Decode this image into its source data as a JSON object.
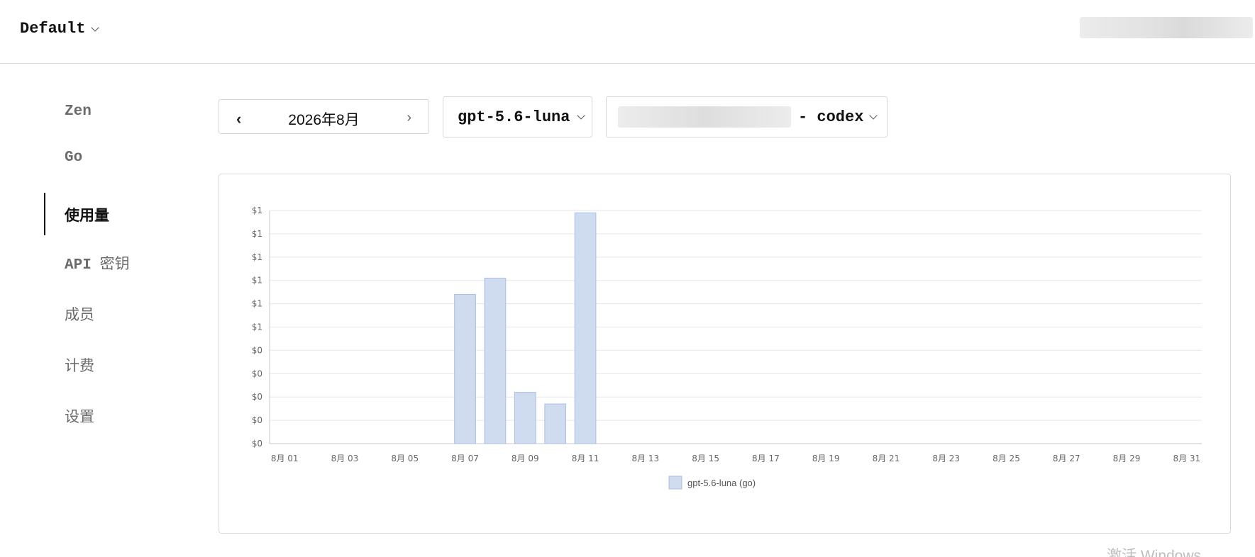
{
  "header": {
    "workspace_label": "Default"
  },
  "sidebar": {
    "items": [
      {
        "label": "Zen",
        "active": false
      },
      {
        "label": "Go",
        "active": false
      },
      {
        "label": "使用量",
        "active": true
      },
      {
        "label": "API",
        "label_suffix": "密钥",
        "active": false
      },
      {
        "label": "成员",
        "active": false
      },
      {
        "label": "计费",
        "active": false
      },
      {
        "label": "设置",
        "active": false
      }
    ]
  },
  "filters": {
    "month": "2026年8月",
    "prev_icon": "‹",
    "next_icon": "›",
    "model": "gpt-5.6-luna",
    "key_suffix": "- codex"
  },
  "chart_data": {
    "type": "bar",
    "categories": [
      "8月 01",
      "8月 02",
      "8月 03",
      "8月 04",
      "8月 05",
      "8月 06",
      "8月 07",
      "8月 08",
      "8月 09",
      "8月 10",
      "8月 11",
      "8月 12",
      "8月 13",
      "8月 14",
      "8月 15",
      "8月 16",
      "8月 17",
      "8月 18",
      "8月 19",
      "8月 20",
      "8月 21",
      "8月 22",
      "8月 23",
      "8月 24",
      "8月 25",
      "8月 26",
      "8月 27",
      "8月 28",
      "8月 29",
      "8月 30",
      "8月 31"
    ],
    "x_tick_labels": [
      "8月 01",
      "8月 03",
      "8月 05",
      "8月 07",
      "8月 09",
      "8月 11",
      "8月 13",
      "8月 15",
      "8月 17",
      "8月 19",
      "8月 21",
      "8月 23",
      "8月 25",
      "8月 27",
      "8月 29",
      "8月 31"
    ],
    "y_tick_labels": [
      "$0",
      "$0",
      "$0",
      "$0",
      "$0",
      "$1",
      "$1",
      "$1",
      "$1",
      "$1",
      "$1"
    ],
    "ylim": [
      0,
      1.0
    ],
    "series": [
      {
        "name": "gpt-5.6-luna (go)",
        "color": "#cfdbee",
        "edge_color": "#a9bfe3",
        "values": [
          0,
          0,
          0,
          0,
          0,
          0,
          0.64,
          0.71,
          0.22,
          0.17,
          0.99,
          0,
          0,
          0,
          0,
          0,
          0,
          0,
          0,
          0,
          0,
          0,
          0,
          0,
          0,
          0,
          0,
          0,
          0,
          0,
          0
        ]
      }
    ],
    "grid": true,
    "legend": "bottom-center"
  },
  "watermark": "激活 Windows"
}
